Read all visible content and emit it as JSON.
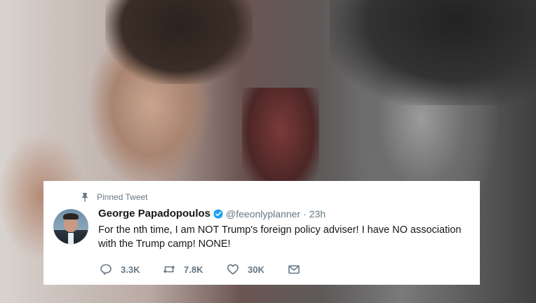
{
  "tweet": {
    "pinned_label": "Pinned Tweet",
    "author_name": "George Papadopoulos",
    "handle": "@feeonlyplanner",
    "separator": "·",
    "time": "23h",
    "text": "For the nth time, I am NOT Trump's foreign policy adviser! I have NO association with the Trump camp! NONE!",
    "replies": "3.3K",
    "retweets": "7.8K",
    "likes": "30K"
  },
  "icons": {
    "pin": "pin-icon",
    "verified": "verified-badge-icon",
    "reply": "reply-icon",
    "retweet": "retweet-icon",
    "like": "heart-icon",
    "message": "envelope-icon"
  },
  "colors": {
    "card_bg": "#ffffff",
    "name_text": "#14171a",
    "muted_text": "#657786",
    "verified_blue": "#1da1f2"
  }
}
